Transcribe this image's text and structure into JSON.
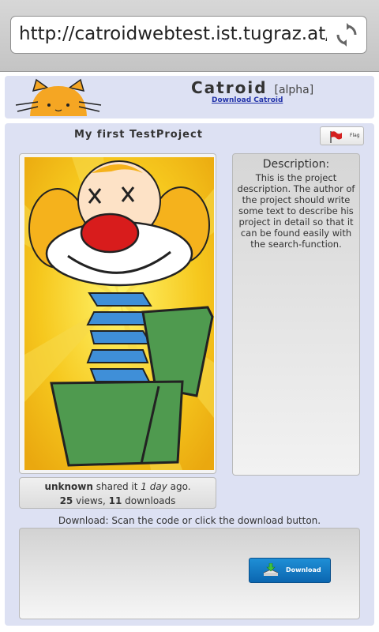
{
  "browser": {
    "url": "http://catroidwebtest.ist.tugraz.at/...",
    "reload_icon": "reload-icon"
  },
  "header": {
    "title": "Catroid",
    "tag": "[alpha]",
    "download_link": "Download Catroid",
    "logo_icon": "catroid-cat-logo"
  },
  "project": {
    "title": "My first TestProject",
    "flag_label": "Flag",
    "owner": "unknown",
    "shared_text": " shared it ",
    "shared_time": "1 day",
    "ago_text": " ago.",
    "views": "25",
    "views_label": " views, ",
    "downloads": "11",
    "downloads_label": " downloads"
  },
  "description": {
    "title": "Description:",
    "text": "This is the project description. The author of the project should write some text to describe his project in detail so that it can be found easily with the search-function."
  },
  "download": {
    "instruction": "Download: Scan the code or click the download button.",
    "button_label": "Download"
  },
  "colors": {
    "panel_bg": "#dde1f3",
    "link": "#2233aa",
    "download_button": "#0b66b0"
  }
}
